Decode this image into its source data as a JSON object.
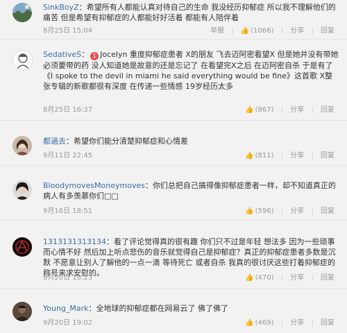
{
  "labels": {
    "report": "举报",
    "share": "分享",
    "reply": "回复"
  },
  "comments": [
    {
      "user": "SinkBoyZ",
      "text": "希望所有人都能认真对待自己的生命 我没经历抑郁症 所以我不理解他们的痛苦 但是希望有抑郁症的人都能好好活着 都能有人陪伴着",
      "date": "8月25日 15:04",
      "likes": "(1066)",
      "avatar": "landscape"
    },
    {
      "user": "SedativeS",
      "badge": "1",
      "text": "Jocelyn 重度抑郁症患者 X的朋友 飞去迈阿密看望X 但是她并没有带她必须要带的药 没人知道她是故意的还是忘记了 在看望完X之后 在迈阿密自杀 于是有了《I spoke to the devil in miami he said everything would be fine》这首歌 X整张专辑的新歌都很有深度 在传递一些情感 19岁经历太多",
      "date": "8月25日 16:37",
      "likes": "(867)",
      "avatar": "sketch"
    },
    {
      "user": "都過去",
      "text": "希望你们能分清楚抑郁症和心情差",
      "date": "9月11日 22:45",
      "likes": "(811)",
      "avatar": "girl"
    },
    {
      "user": "BloodymovesMoneymoves",
      "text": "你们总把自己搞得像抑郁症患者一样，却不知道真正的病人有多羡慕你们□□",
      "date": "9月16日 18:51",
      "likes": "(596)",
      "avatar": "dark-hair"
    },
    {
      "user": "1313131313134",
      "text": "看了评论觉得真的很有趣 你们只不过是年轻 想法多 因为一些琐事而心情不好 然后加上听点悲伤的音乐就觉得自己是抑郁症？真正的抑郁症患者多数是沉默 不愿意让别人了解他的一点一滴 等待死亡 或者自杀 我真的很讨厌这些打着抑郁症的称号来求安慰的。",
      "date": "9月20日 18:23",
      "likes": "(470)",
      "avatar": "red-art"
    },
    {
      "user": "Young_Mark",
      "text": "全地球的抑郁症都在网易云了 佛了佛了",
      "date": "9月20日 19:02",
      "likes": "(469)",
      "avatar": "person"
    }
  ]
}
